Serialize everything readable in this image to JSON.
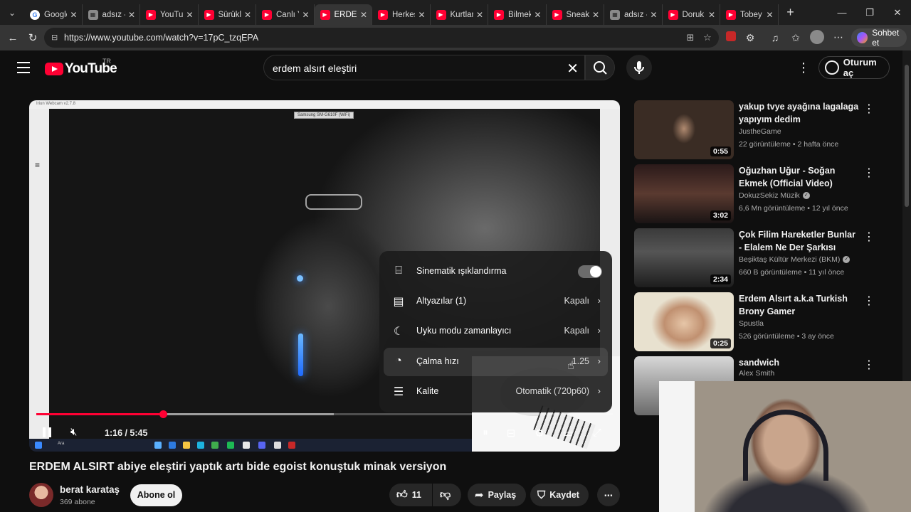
{
  "browser": {
    "tabs": [
      {
        "label": "Google",
        "icon": "google-icon"
      },
      {
        "label": "adsız - İ",
        "icon": "image-icon"
      },
      {
        "label": "YouTub",
        "icon": "youtube-icon"
      },
      {
        "label": "Sürükle",
        "icon": "youtube-icon"
      },
      {
        "label": "Canlı Ya",
        "icon": "youtube-icon"
      },
      {
        "label": "ERDEM",
        "icon": "youtube-icon",
        "active": true
      },
      {
        "label": "Herkes",
        "icon": "youtube-icon"
      },
      {
        "label": "Kurtlar",
        "icon": "youtube-icon"
      },
      {
        "label": "Bilmek",
        "icon": "youtube-icon"
      },
      {
        "label": "Sneaky",
        "icon": "youtube-icon"
      },
      {
        "label": "adsız - İ",
        "icon": "image-icon"
      },
      {
        "label": "Doruk Y",
        "icon": "youtube-icon"
      },
      {
        "label": "Tobey M",
        "icon": "youtube-icon"
      }
    ],
    "url": "https://www.youtube.com/watch?v=17pC_tzqEPA",
    "copilot_label": "Sohbet et",
    "accent": "#ff0033"
  },
  "youtube": {
    "logo_text": "YouTube",
    "country_code": "TR",
    "search_value": "erdem alsırt eleştiri",
    "signin_label": "Oturum aç"
  },
  "player": {
    "webcam_title": "Iriun Webcam v2.7.8",
    "camera_label": "Samsung SM-G610F (WiFi)",
    "taskbar_search": "Ara",
    "time": "1:16 / 5:45",
    "progress": 0.2203,
    "buffered": 0.516,
    "settings": {
      "cinematic_label": "Sinematik ışıklandırma",
      "cinematic_on": true,
      "subtitles_label": "Altyazılar (1)",
      "subtitles_value": "Kapalı",
      "sleep_label": "Uyku modu zamanlayıcı",
      "sleep_value": "Kapalı",
      "speed_label": "Çalma hızı",
      "speed_value": "1.25",
      "quality_label": "Kalite",
      "quality_value": "Otomatik (720p60)"
    }
  },
  "video": {
    "title": "ERDEM ALSIRT abiye eleştiri yaptık artı bide egoist konuştuk minak versiyon",
    "channel": "berat karataş",
    "subscribers": "369 abone",
    "subscribe_label": "Abone ol",
    "likes": "11",
    "share_label": "Paylaş",
    "save_label": "Kaydet"
  },
  "recommendations": [
    {
      "title": "yakup tvye ayağına lagalaga yapıyım dedim",
      "channel": "JustheGame",
      "meta": "22 görüntüleme • 2 hafta önce",
      "duration": "0:55",
      "verified": false
    },
    {
      "title": "Oğuzhan Uğur - Soğan Ekmek (Official Video)",
      "channel": "DokuzSekiz Müzik",
      "meta": "6,6 Mn görüntüleme • 12 yıl önce",
      "duration": "3:02",
      "verified": true
    },
    {
      "title": "Çok Filim Hareketler Bunlar - Elalem Ne Der Şarkısı",
      "channel": "Beşiktaş Kültür Merkezi (BKM)",
      "meta": "660 B görüntüleme • 11 yıl önce",
      "duration": "2:34",
      "verified": true
    },
    {
      "title": "Erdem Alsırt a.k.a Turkish Brony Gamer",
      "channel": "Spustla",
      "meta": "526 görüntüleme • 3 ay önce",
      "duration": "0:25",
      "verified": false
    },
    {
      "title": "sandwich",
      "channel": "Alex Smith",
      "meta": "",
      "duration": "",
      "verified": false
    }
  ]
}
